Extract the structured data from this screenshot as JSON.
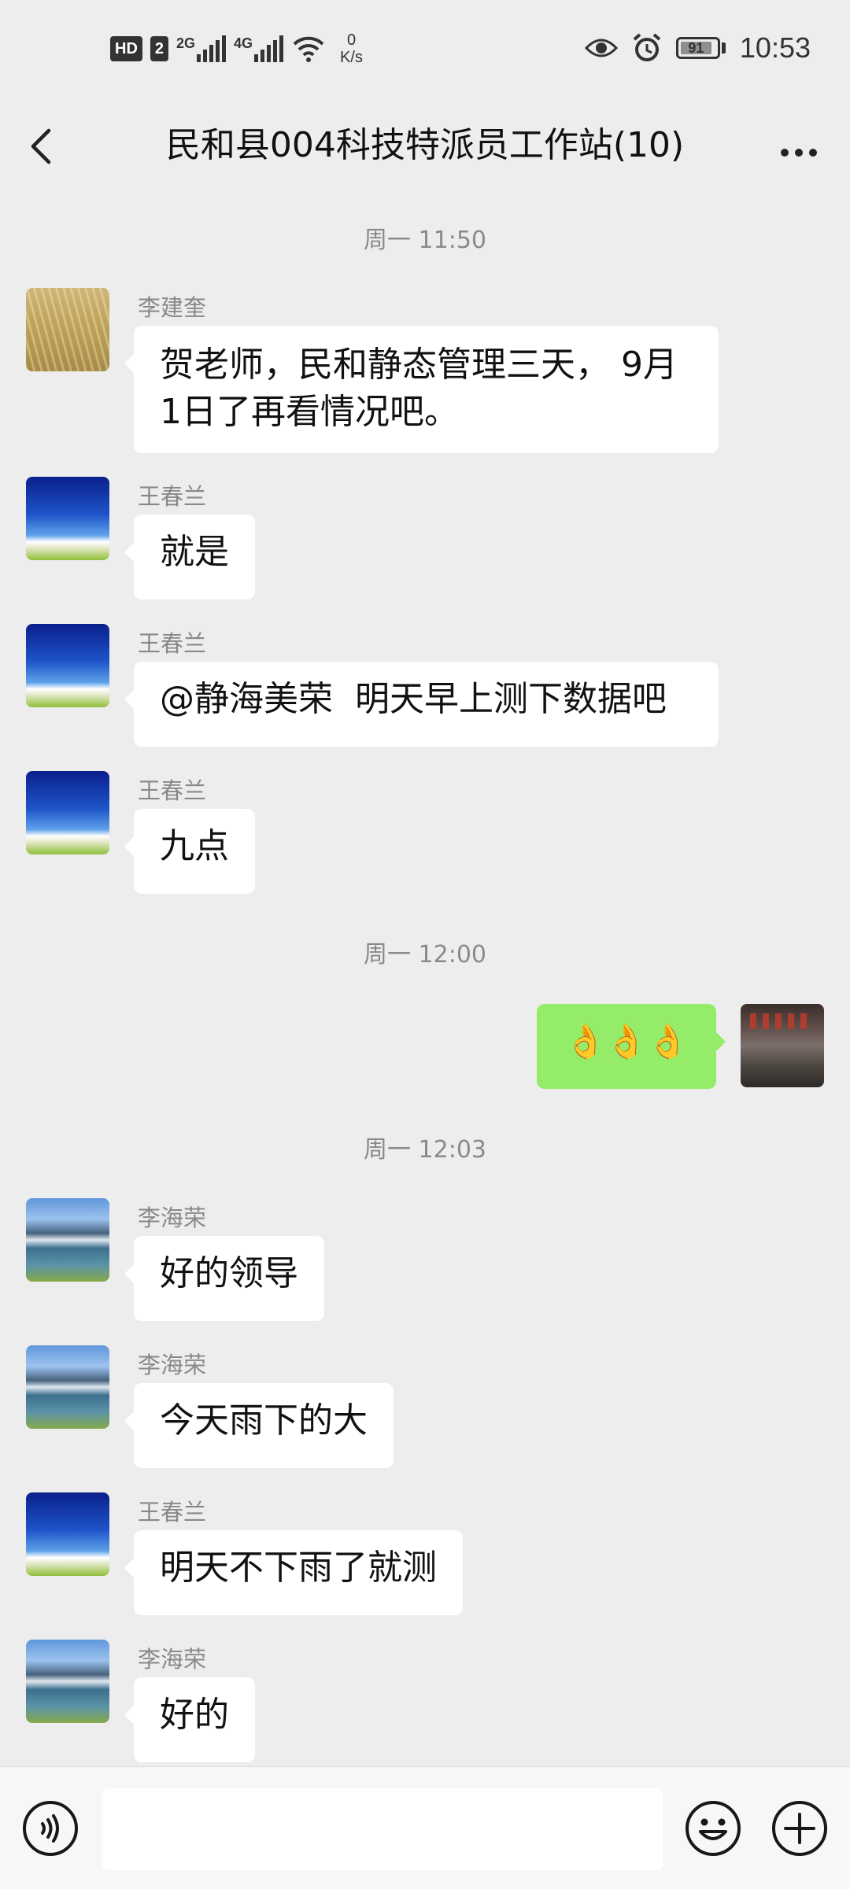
{
  "status_bar": {
    "hd": "HD",
    "sim": "2",
    "net1": "2G",
    "net2": "4G",
    "speed_value": "0",
    "speed_unit": "K/s",
    "battery": "91",
    "time": "10:53"
  },
  "header": {
    "title": "民和县004科技特派员工作站(10)",
    "back_icon": "chevron-left-icon",
    "more_icon": "more-dots-icon"
  },
  "chat": {
    "timestamps": [
      "周一 11:50",
      "周一 12:00",
      "周一 12:03"
    ],
    "messages": [
      {
        "sender": "李建奎",
        "text": "贺老师，民和静态管理三天， 9月1日了再看情况吧。",
        "line1": "贺老师，民和静态管理三天， 9月",
        "line2": "1日了再看情况吧。"
      },
      {
        "sender": "王春兰",
        "text": "就是"
      },
      {
        "sender": "王春兰",
        "text": "@静海美荣  明天早上测下数据吧"
      },
      {
        "sender": "王春兰",
        "text": "九点"
      },
      {
        "sender": "",
        "text": "👌👌👌"
      },
      {
        "sender": "李海荣",
        "text": "好的领导"
      },
      {
        "sender": "李海荣",
        "text": "今天雨下的大"
      },
      {
        "sender": "王春兰",
        "text": "明天不下雨了就测"
      },
      {
        "sender": "李海荣",
        "text": "好的"
      }
    ]
  },
  "input_bar": {
    "voice_icon": "voice-icon",
    "text_value": "",
    "emoji_icon": "emoji-icon",
    "plus_icon": "plus-icon"
  },
  "colors": {
    "background": "#ededed",
    "my_bubble": "#95ec69",
    "other_bubble": "#ffffff"
  }
}
